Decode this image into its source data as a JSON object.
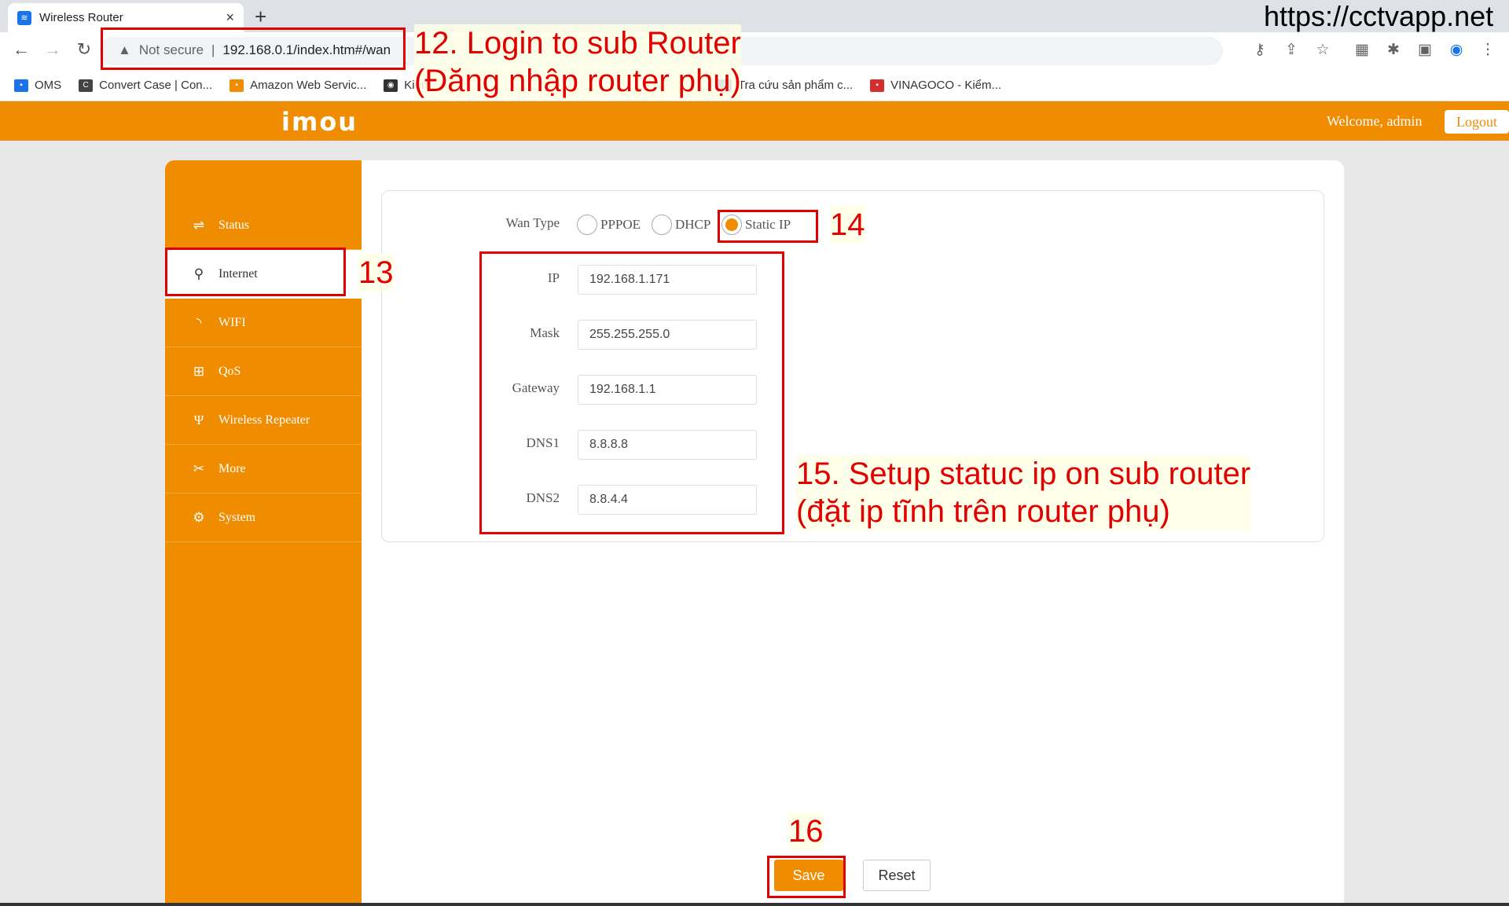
{
  "browser": {
    "tab_title": "Wireless Router",
    "tab_close": "×",
    "new_tab": "+",
    "security": "Not secure",
    "url": "192.168.0.1/index.htm#/wan",
    "bookmarks": [
      {
        "label": "OMS",
        "color": "#1a73e8"
      },
      {
        "label": "Convert Case | Con...",
        "color": "#444"
      },
      {
        "label": "Amazon Web Servic...",
        "color": "#f08c00"
      },
      {
        "label": "Kiểm...",
        "color": "#333"
      },
      {
        "label": "Tra cứu sản phẩm c...",
        "color": "#1565c0"
      },
      {
        "label": "VINAGOCO - Kiểm...",
        "color": "#d32f2f"
      }
    ]
  },
  "router": {
    "logo": "imou",
    "welcome": "Welcome, admin",
    "logout": "Logout",
    "sidebar": [
      {
        "label": "Status",
        "icon": "router-icon"
      },
      {
        "label": "Internet",
        "icon": "network-icon",
        "active": true
      },
      {
        "label": "WIFI",
        "icon": "wifi-icon"
      },
      {
        "label": "QoS",
        "icon": "qos-icon"
      },
      {
        "label": "Wireless Repeater",
        "icon": "antenna-icon"
      },
      {
        "label": "More",
        "icon": "tools-icon"
      },
      {
        "label": "System",
        "icon": "gear-icon"
      }
    ],
    "wan": {
      "label": "Wan Type",
      "options": [
        "PPPOE",
        "DHCP",
        "Static IP"
      ],
      "selected": "Static IP",
      "fields": [
        {
          "label": "IP",
          "value": "192.168.1.171"
        },
        {
          "label": "Mask",
          "value": "255.255.255.0"
        },
        {
          "label": "Gateway",
          "value": "192.168.1.1"
        },
        {
          "label": "DNS1",
          "value": "8.8.8.8"
        },
        {
          "label": "DNS2",
          "value": "8.8.4.4"
        }
      ]
    },
    "save": "Save",
    "reset": "Reset"
  },
  "annotations": {
    "n12_line1": "12. Login to sub Router",
    "n12_line2": "(Đăng nhập router phụ)",
    "n13": "13",
    "n14": "14",
    "n15_line1": "15. Setup statuc ip on sub router",
    "n15_line2": "(đặt ip tĩnh trên router phụ)",
    "n16": "16",
    "watermark": "https://cctvapp.net",
    "color": "#e00000"
  }
}
